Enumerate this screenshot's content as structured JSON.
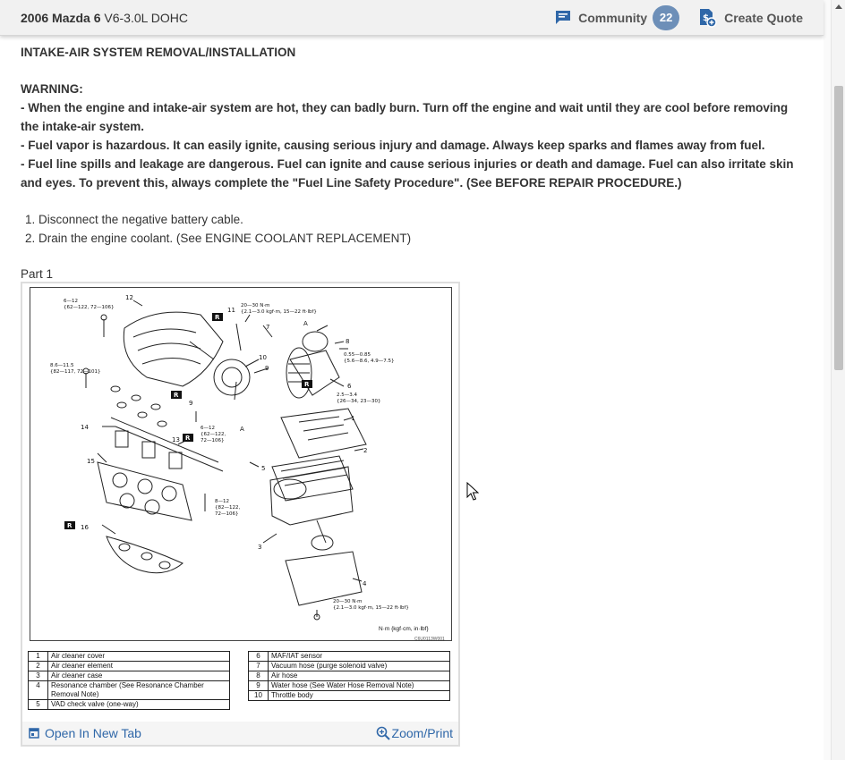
{
  "header": {
    "vehicle_bold": "2006 Mazda 6",
    "vehicle_rest": " V6-3.0L DOHC",
    "community_label": "Community",
    "community_count": "22",
    "quote_label": "Create Quote"
  },
  "doc": {
    "title": "INTAKE-AIR SYSTEM REMOVAL/INSTALLATION",
    "warning_label": "WARNING:",
    "warnings": [
      " -  When the engine and intake-air system are hot, they can badly burn. Turn off the engine and wait until they are cool before removing the intake-air system.",
      " -  Fuel vapor is hazardous. It can easily ignite, causing serious injury and damage. Always keep sparks and flames away from fuel.",
      " -  Fuel line spills and leakage are dangerous. Fuel can ignite and cause serious injuries or death and damage. Fuel can also irritate skin and eyes. To prevent this, always complete the \"Fuel Line Safety Procedure\". (See BEFORE REPAIR PROCEDURE.)"
    ],
    "steps": [
      "1. Disconnect the negative battery cable.",
      "2. Drain the engine coolant. (See ENGINE COOLANT REPLACEMENT)"
    ],
    "part_label": "Part 1"
  },
  "figure": {
    "units": "N·m {kgf·cm, in·lbf}",
    "code": "C6U0113W001",
    "torque_labels": [
      "6—12",
      "{62—122, 72—106}",
      "20—30 N·m",
      "{2.1—3.0 kgf·m, 15—22 ft·lbf}",
      "0.55—0.85",
      "{5.6—8.6, 4.9—7.5}",
      "8.6—11.5",
      "{82—117, 72—101}",
      "2.5—3.4",
      "{26—34, 23—30}",
      "6—12",
      "{62—122,",
      "72—106}",
      "8—12",
      "{82—122,",
      "72—106}",
      "20—30 N·m",
      "{2.1—3.0 kgf·m, 15—22 ft·lbf}"
    ],
    "callouts": [
      "12",
      "11",
      "7",
      "A",
      "8",
      "10",
      "9",
      "6",
      "1",
      "14",
      "13",
      "A",
      "5",
      "2",
      "15",
      "16",
      "3",
      "4",
      "9"
    ],
    "r_mark": "R",
    "legend_left": [
      {
        "num": "1",
        "name": "Air cleaner cover"
      },
      {
        "num": "2",
        "name": "Air cleaner element"
      },
      {
        "num": "3",
        "name": "Air cleaner case"
      },
      {
        "num": "4",
        "name": "Resonance chamber (See Resonance Chamber Removal Note)"
      },
      {
        "num": "5",
        "name": "VAD check valve (one-way)"
      }
    ],
    "legend_right": [
      {
        "num": "6",
        "name": "MAF/IAT sensor"
      },
      {
        "num": "7",
        "name": "Vacuum hose (purge solenoid valve)"
      },
      {
        "num": "8",
        "name": "Air hose"
      },
      {
        "num": "9",
        "name": "Water hose (See Water Hose Removal Note)"
      },
      {
        "num": "10",
        "name": "Throttle body"
      }
    ],
    "open_tab": "Open In New Tab",
    "zoom": "Zoom/Print"
  },
  "colors": {
    "link": "#2f67a8",
    "badge": "#6d8fb8",
    "icon": "#2f67a8"
  }
}
